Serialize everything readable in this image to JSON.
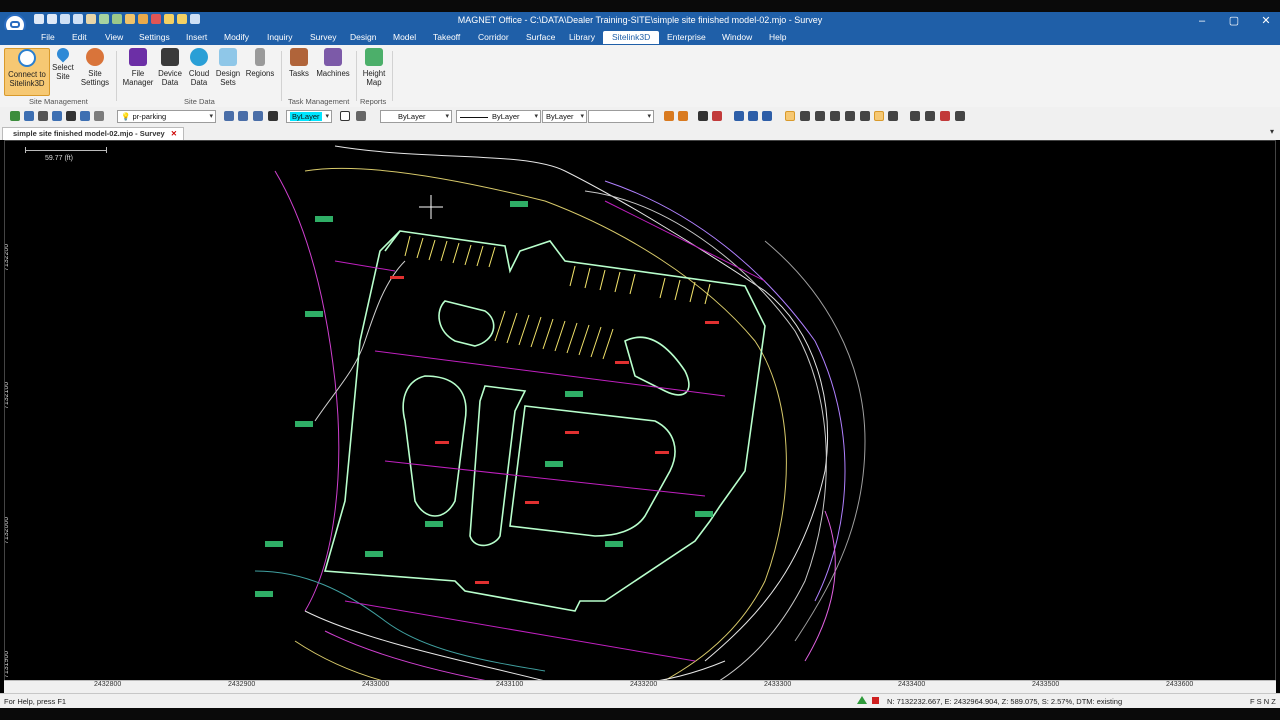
{
  "window": {
    "title": "MAGNET Office - C:\\DATA\\Dealer Training-SITE\\simple site finished model-02.mjo - Survey",
    "controls": [
      "–",
      "▢",
      "✕"
    ]
  },
  "menu": [
    "File",
    "Edit",
    "View",
    "Settings",
    "Insert",
    "Modify",
    "Inquiry",
    "Survey",
    "Design",
    "Model",
    "Takeoff",
    "Corridor",
    "Surface",
    "Library",
    "Sitelink3D",
    "Enterprise",
    "Window",
    "Help"
  ],
  "active_menu": "Sitelink3D",
  "ribbon": {
    "buttons": [
      {
        "name": "connect-sitelink3d-button",
        "line1": "Connect to",
        "line2": "Sitelink3D",
        "icon": "cloud-connect-icon"
      },
      {
        "name": "select-site-button",
        "line1": "Select",
        "line2": "Site",
        "icon": "map-pin-icon"
      },
      {
        "name": "site-settings-button",
        "line1": "Site",
        "line2": "Settings",
        "icon": "gear-pin-icon"
      },
      {
        "name": "file-manager-button",
        "line1": "File",
        "line2": "Manager",
        "icon": "folder-icon"
      },
      {
        "name": "device-data-button",
        "line1": "Device",
        "line2": "Data",
        "icon": "device-icon"
      },
      {
        "name": "cloud-data-button",
        "line1": "Cloud",
        "line2": "Data",
        "icon": "cloud-icon"
      },
      {
        "name": "design-sets-button",
        "line1": "Design",
        "line2": "Sets",
        "icon": "layers-icon"
      },
      {
        "name": "regions-button",
        "line1": "Regions",
        "line2": "",
        "icon": "region-icon"
      },
      {
        "name": "tasks-button",
        "line1": "Tasks",
        "line2": "",
        "icon": "tasks-icon"
      },
      {
        "name": "machines-button",
        "line1": "Machines",
        "line2": "",
        "icon": "machine-icon"
      },
      {
        "name": "height-map-button",
        "line1": "Height",
        "line2": "Map",
        "icon": "height-map-icon"
      }
    ],
    "groups": [
      "Site Management",
      "Site Data",
      "Task Management",
      "Reports"
    ]
  },
  "toolbar": {
    "layer_combo": "pr-parking",
    "color_combo": "ByLayer",
    "color_swatch": "#00e5ff",
    "linetype_combo": "ByLayer",
    "lineweight_combo": "ByLayer",
    "lineweight2_combo": "ByLayer",
    "extra_combo": ""
  },
  "document_tab": {
    "label": "simple site finished model-02.mjo - Survey",
    "close": "✕"
  },
  "viewport": {
    "scale_label": "59.77  (ft)",
    "y_ticks": [
      "7132200",
      "7132100",
      "7132000",
      "7131900"
    ],
    "x_ticks": [
      "2432800",
      "2432900",
      "2433000",
      "2433100",
      "2433200",
      "2433300",
      "2433400",
      "2433500",
      "2433600"
    ]
  },
  "status": {
    "help": "For Help, press F1",
    "coords": "N: 7132232.667, E: 2432964.904, Z: 589.075, S: 2.57%, DTM: existing",
    "flags": "F S N Z"
  },
  "colors": {
    "title_bar": "#1f5fa8",
    "ribbon_bg": "#f3f3f3",
    "selected_button": "#f6c873",
    "canvas_bg": "#000000"
  }
}
